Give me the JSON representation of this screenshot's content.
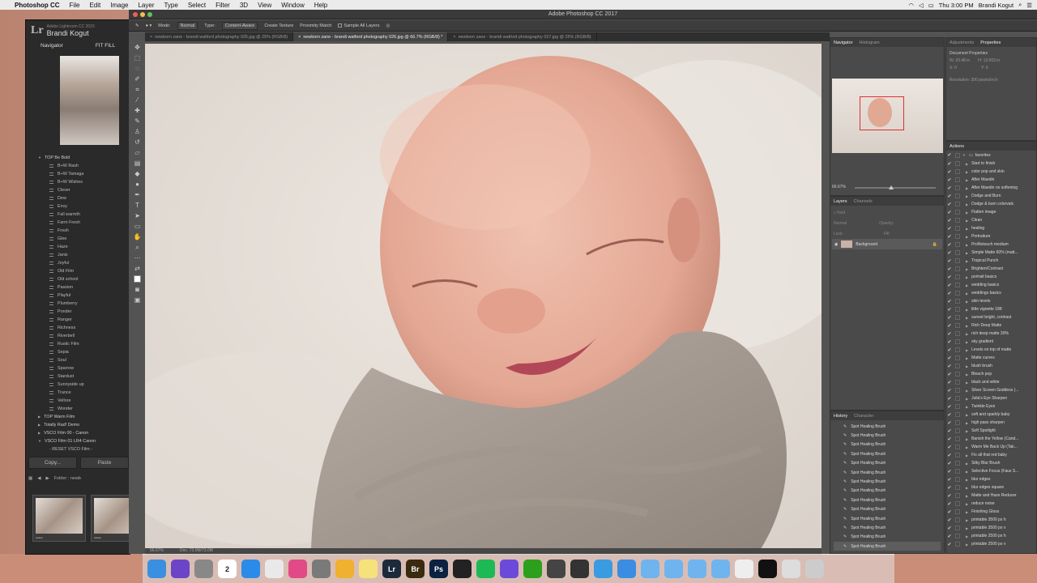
{
  "menubar": {
    "apple": "",
    "app": "Photoshop CC",
    "items": [
      "File",
      "Edit",
      "Image",
      "Layer",
      "Type",
      "Select",
      "Filter",
      "3D",
      "View",
      "Window",
      "Help"
    ],
    "clock": "Thu 3:00 PM",
    "user": "Brandi Kogut"
  },
  "lightroom": {
    "app_line": "Adobe Lightroom CC 2015",
    "user": "Brandi Kogut",
    "navigator": "Navigator",
    "fit": "FIT",
    "fill": "FILL",
    "group_open": "TOP Be Bold",
    "presets": [
      "B+W Rash",
      "B+W Tamaga",
      "B+W Wishes",
      "Clever",
      "Dew",
      "Envy",
      "Fall warmth",
      "Farm Fresh",
      "Fresh",
      "Glee",
      "Haze",
      "Janis",
      "Joyful",
      "Old Film",
      "Old school",
      "Passion",
      "Playful",
      "Plumberry",
      "Ponder",
      "Ranger",
      "Richness",
      "Riverbell",
      "Rustic Film",
      "Sepia",
      "Soul",
      "Sparrow",
      "Stardust",
      "Sunnyside up",
      "Trance",
      "Vellore",
      "Wonder"
    ],
    "groups": [
      "TOP Warm Film",
      "Totally Rad! Demo",
      "VSCO Film 00 - Canon",
      "VSCO Film 01 LR4 Canon"
    ],
    "reset": "- RESET VSCO Film -",
    "copy": "Copy...",
    "paste": "Paste",
    "folder": "Folder : newb",
    "stars": "•••••"
  },
  "ps": {
    "title": "Adobe Photoshop CC 2017",
    "options": {
      "mode_label": "Mode:",
      "mode": "Normal",
      "type_label": "Type:",
      "content_aware": "Content-Aware",
      "create_texture": "Create Texture",
      "proximity": "Proximity Match",
      "sample_all": "Sample All Layers"
    },
    "tabs": [
      "newborn zane - brandi watford photography 025.jpg @ 25% (RGB/8)",
      "newborn zane - brandi watford photography 026.jpg @ 66.7% (RGB/8) *",
      "newborn zane - brandi watford photography 027.jpg @ 25% (RGB/8)"
    ],
    "zoom": "66.67%",
    "doc": "Doc: 73.0M/73.0M",
    "navigator": {
      "tab1": "Navigator",
      "tab2": "Histogram",
      "zoom": "66.67%"
    },
    "adjustments": {
      "tab1": "Adjustments",
      "tab2": "Properties",
      "doc_props": "Document Properties",
      "w": "W: 20.48 in",
      "h": "H: 13.653 in",
      "x": "X: 0",
      "y": "Y: 0",
      "resolution": "Resolution: 300 pixels/inch"
    },
    "layers": {
      "tab1": "Layers",
      "tab2": "Channels",
      "kind": "Kind",
      "blend": "Normal",
      "opacity": "Opacity:",
      "lock": "Lock:",
      "fill": "Fill:",
      "layer": "Background"
    },
    "history": {
      "tab1": "History",
      "tab2": "Character",
      "item": "Spot Healing Brush",
      "count": 14
    },
    "actions": {
      "title": "Actions",
      "set": "favorites",
      "items": [
        "Start to finish",
        "color pop and skin",
        "After Maedin",
        "After Maedin no softening",
        "Dodge and Burn",
        "Dodge & burn colorvals",
        "Flatten image",
        "Clean",
        "healing",
        "Portraiture",
        "ProNetouch medium",
        "Simple Matte 60% (matt...",
        "Tropical Punch",
        "Brighten/Contrast",
        "portrait basics",
        "wedding basics",
        "weddings basics",
        "skin tevels",
        "little vignette 188",
        "sunset bright, contrast",
        "Rich Deep Matte",
        "rich deep matte 30%",
        "sky gradient",
        "Levels on top of matte",
        "Matte curves",
        "blush brush",
        "Bleach pop",
        "black and white",
        "Silver Screen Goddess (...",
        "Julia's Eye Sharpen",
        "Twinkle Eyes",
        "soft and sparkly baby",
        "high pass sharpen",
        "Soft Spotlight",
        "Banish the Yellow (Cand...",
        "Warm Me Back Up (Tak...",
        "Fix all that red baby",
        "Silky Blur Brush",
        "Selective Focus (Faux S...",
        "blur edges",
        "blur edges square",
        "Matte and Haze Reducer",
        "reduce noise",
        "Finishing Gloss",
        "printable 3500 px h",
        "printable 3500 px v",
        "printable 2500 px h",
        "printable 2500 px v"
      ]
    }
  },
  "dock": {
    "items": [
      "finder",
      "siri",
      "launchpad",
      "calendar",
      "safari",
      "chrome",
      "itunes",
      "prefs",
      "photos",
      "notes",
      "lightroom",
      "bridge",
      "photoshop",
      "alfred",
      "spotify",
      "imovie",
      "quickbooks",
      "x",
      "notch",
      "facetime",
      "messages",
      "folder",
      "folder",
      "folder",
      "folder",
      "doc",
      "terminal",
      "finder2",
      "trash"
    ],
    "calendar_day": "2"
  }
}
